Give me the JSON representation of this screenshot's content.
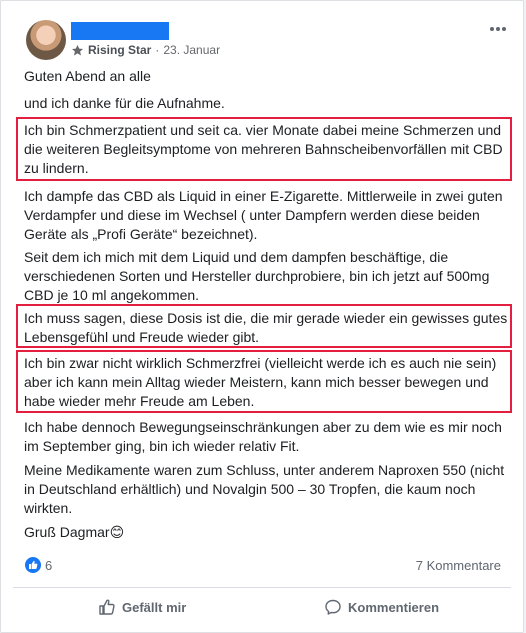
{
  "post": {
    "badge": "Rising Star",
    "separator": "·",
    "date": "23. Januar",
    "paragraphs": [
      "Guten Abend an alle",
      "und ich danke für die Aufnahme.",
      "Ich bin Schmerzpatient und seit ca. vier Monate dabei meine Schmerzen und die weiteren Begleitsymptome von mehreren Bahnscheibenvorfällen mit CBD zu lindern.",
      "Ich dampfe das CBD als Liquid in einer E-Zigarette. Mittlerweile in zwei guten Verdampfer und diese im Wechsel ( unter Dampfern werden diese beiden Geräte als „Profi Geräte“ bezeichnet).",
      "Seit dem ich mich mit dem Liquid und dem dampfen beschäftige, die verschiedenen Sorten und Hersteller durchprobiere, bin ich jetzt auf 500mg CBD je 10 ml angekommen.",
      "Ich muss sagen, diese Dosis ist die, die mir gerade wieder ein gewisses gutes Lebensgefühl und Freude wieder gibt.",
      "Ich bin zwar nicht wirklich Schmerzfrei (vielleicht werde ich es auch nie sein) aber ich kann mein Alltag wieder Meistern, kann mich besser bewegen und habe wieder mehr Freude am Leben.",
      "Ich habe dennoch Bewegungseinschränkungen aber zu dem wie es mir noch im September ging, bin ich wieder relativ Fit.",
      "Meine Medikamente waren zum Schluss, unter anderem Naproxen 550 (nicht in Deutschland erhältlich) und Novalgin 500 – 30 Tropfen, die kaum noch wirkten.",
      "Gruß Dagmar😊"
    ],
    "highlight_color": "#e41e3f"
  },
  "footer": {
    "like_count": "6",
    "comments_label": "7 Kommentare",
    "like_action": "Gefällt mir",
    "comment_action": "Kommentieren"
  },
  "icons": {
    "more": "more-options-icon",
    "badge": "rising-star-badge-icon",
    "like_reaction": "like-reaction-icon",
    "like_action": "thumbs-up-icon",
    "comment_action": "comment-icon"
  },
  "colors": {
    "brand": "#1877f2",
    "secondary_text": "#65676b"
  }
}
